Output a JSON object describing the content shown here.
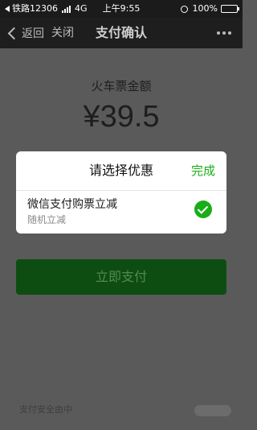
{
  "status_bar": {
    "carrier": "铁路12306",
    "network": "4G",
    "time": "上午9:55",
    "battery": "100%"
  },
  "nav": {
    "back_label": "返回",
    "close_label": "关闭",
    "title": "支付确认"
  },
  "payment": {
    "amount_label": "火车票金额",
    "amount": "¥39.5",
    "pay_button": "立即支付",
    "footer_text": "支付安全由中"
  },
  "discount_modal": {
    "title": "请选择优惠",
    "done_label": "完成",
    "options": [
      {
        "title": "微信支付购票立减",
        "subtitle": "随机立减",
        "selected": true
      }
    ]
  },
  "colors": {
    "accent_green": "#1aad19",
    "overlay": "#5a5a5a"
  }
}
